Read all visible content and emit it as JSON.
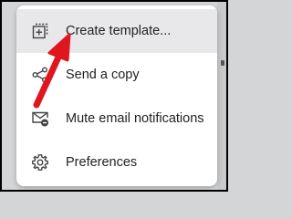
{
  "menu": {
    "items": [
      {
        "label": "Create template...",
        "icon": "add-template-icon",
        "highlighted": true
      },
      {
        "label": "Send a copy",
        "icon": "share-icon"
      },
      {
        "label": "Mute email notifications",
        "icon": "mail-muted-icon"
      },
      {
        "label": "Preferences",
        "icon": "gear-icon"
      }
    ]
  },
  "annotation": {
    "color": "#e0161e",
    "points_to": "Create template..."
  }
}
